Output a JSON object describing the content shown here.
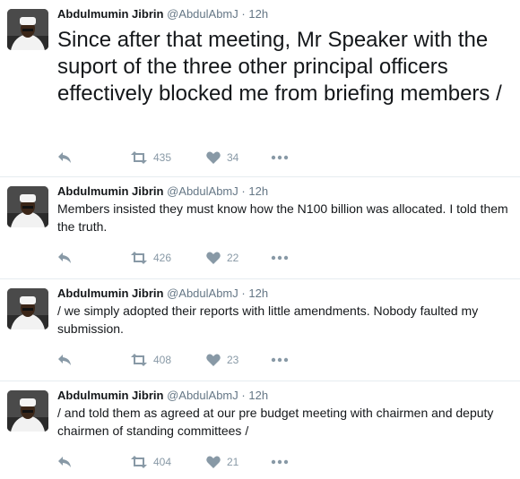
{
  "tweets": [
    {
      "name": "Abdulmumin Jibrin",
      "handle": "@AbdulAbmJ",
      "time": "12h",
      "text": "Since after that meeting, Mr Speaker with the suport of the three other principal officers effectively blocked me from briefing members /",
      "retweets": "435",
      "likes": "34"
    },
    {
      "name": "Abdulmumin Jibrin",
      "handle": "@AbdulAbmJ",
      "time": "12h",
      "text": "Members insisted they must know how the N100 billion was allocated. I told them the truth.",
      "retweets": "426",
      "likes": "22"
    },
    {
      "name": "Abdulmumin Jibrin",
      "handle": "@AbdulAbmJ",
      "time": "12h",
      "text": "/ we simply adopted their reports with little amendments. Nobody faulted my submission.",
      "retweets": "408",
      "likes": "23"
    },
    {
      "name": "Abdulmumin Jibrin",
      "handle": "@AbdulAbmJ",
      "time": "12h",
      "text": "/ and told them as agreed at our pre budget meeting with chairmen and deputy chairmen of standing committees /",
      "retweets": "404",
      "likes": "21"
    }
  ],
  "separator": "·",
  "icons": {
    "reply": "reply-icon",
    "retweet": "retweet-icon",
    "like": "heart-icon",
    "more": "more-icon"
  },
  "colors": {
    "icon": "#8899a6",
    "muted": "#657786",
    "text": "#14171a",
    "border": "#e6ecf0"
  }
}
